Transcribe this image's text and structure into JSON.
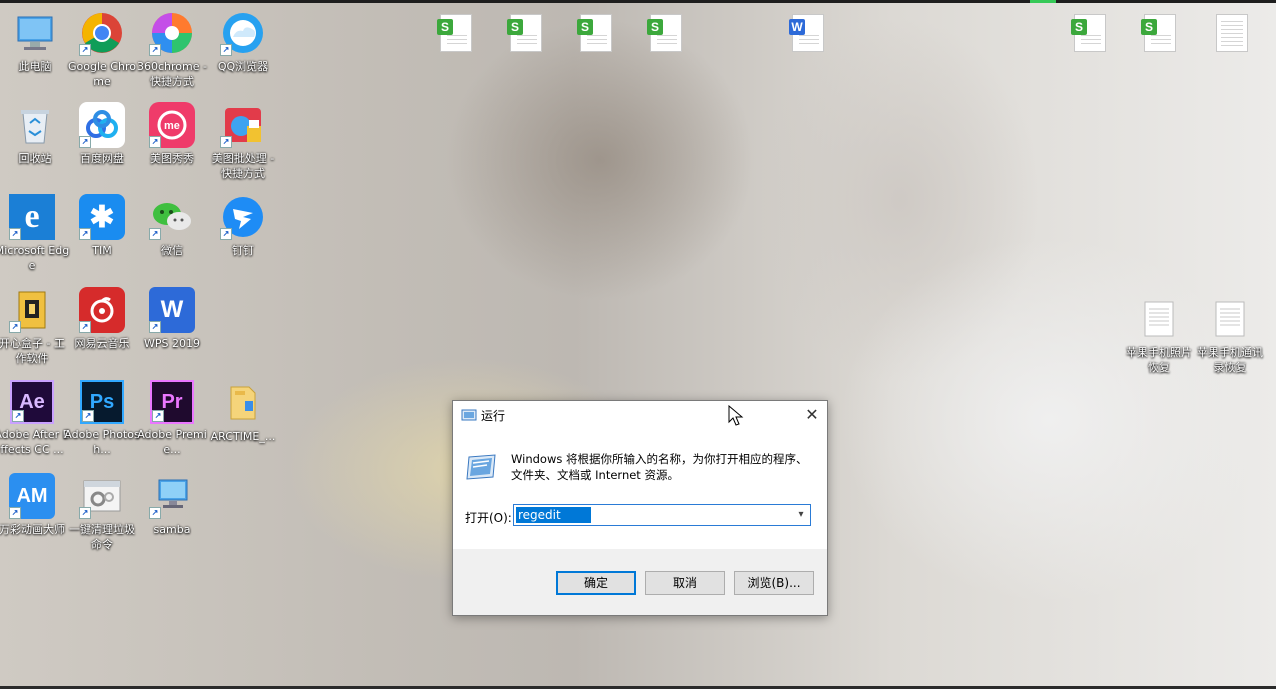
{
  "desktop_icons": [
    {
      "label": "此电脑",
      "icon": "this-pc-icon"
    },
    {
      "label": "Google Chrome",
      "icon": "chrome-icon"
    },
    {
      "label": "360chrome - 快捷方式",
      "icon": "360chrome-icon"
    },
    {
      "label": "QQ浏览器",
      "icon": "qq-browser-icon"
    },
    {
      "label": "回收站",
      "icon": "recycle-bin-icon"
    },
    {
      "label": "百度网盘",
      "icon": "baidu-netdisk-icon"
    },
    {
      "label": "美图秀秀",
      "icon": "meitu-icon"
    },
    {
      "label": "美图批处理 - 快捷方式",
      "icon": "meitu-batch-icon"
    },
    {
      "label": "Microsoft Edge",
      "icon": "edge-icon"
    },
    {
      "label": "TIM",
      "icon": "tim-icon"
    },
    {
      "label": "微信",
      "icon": "wechat-icon"
    },
    {
      "label": "钉钉",
      "icon": "dingtalk-icon"
    },
    {
      "label": "开心盒子 - 工作软件",
      "icon": "happy-box-icon"
    },
    {
      "label": "网易云音乐",
      "icon": "netease-music-icon"
    },
    {
      "label": "WPS 2019",
      "icon": "wps-icon"
    },
    {
      "label": "Adobe After Effects CC ...",
      "icon": "after-effects-icon"
    },
    {
      "label": "Adobe Photosh...",
      "icon": "photoshop-icon"
    },
    {
      "label": "Adobe Premie...",
      "icon": "premiere-icon"
    },
    {
      "label": "ARCTIME_...",
      "icon": "folder-icon"
    },
    {
      "label": "万彩动画大师",
      "icon": "animation-master-icon"
    },
    {
      "label": "一键清理垃圾命令",
      "icon": "cleanup-script-icon"
    },
    {
      "label": "samba",
      "icon": "network-computer-icon"
    },
    {
      "label": "苹果手机照片恢复",
      "icon": "text-document-icon"
    },
    {
      "label": "苹果手机通讯录恢复",
      "icon": "text-document-icon"
    }
  ],
  "icon_glyphs": {
    "ae": "Ae",
    "ps": "Ps",
    "pr": "Pr",
    "am": "AM",
    "s": "S",
    "w": "W"
  },
  "run_dialog": {
    "title": "运行",
    "description": "Windows 将根据你所输入的名称，为你打开相应的程序、文件夹、文档或 Internet 资源。",
    "open_label": "打开(O):",
    "open_value": "regedit",
    "ok_label": "确定",
    "cancel_label": "取消",
    "browse_label": "浏览(B)...",
    "close_glyph": "✕"
  },
  "colors": {
    "accent": "#0078d7",
    "taskbar_accent": "#36c957",
    "wps_sheet": "#3ca83c",
    "wps_writer": "#2d6ad8"
  }
}
